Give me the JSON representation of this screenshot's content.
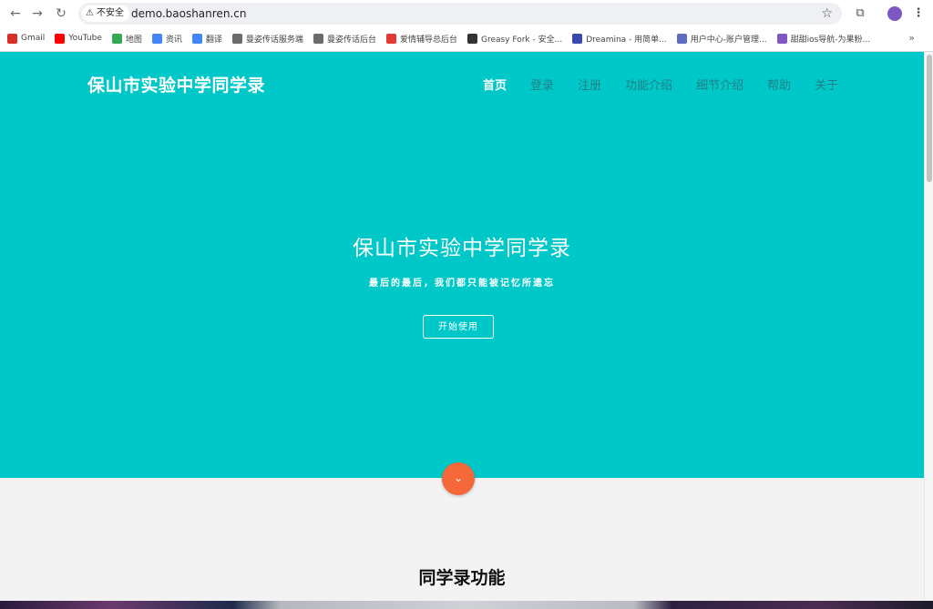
{
  "browser": {
    "security_label": "不安全",
    "url": "demo.baoshanren.cn",
    "bookmarks": [
      {
        "label": "Gmail",
        "color": "#d93025"
      },
      {
        "label": "YouTube",
        "color": "#ff0000"
      },
      {
        "label": "地图",
        "color": "#34a853"
      },
      {
        "label": "资讯",
        "color": "#4285f4"
      },
      {
        "label": "翻译",
        "color": "#4285f4"
      },
      {
        "label": "曼姿传话服务端",
        "color": "#6b6b6b"
      },
      {
        "label": "曼姿传话后台",
        "color": "#6b6b6b"
      },
      {
        "label": "爱情辅导总后台",
        "color": "#e53935"
      },
      {
        "label": "Greasy Fork - 安全...",
        "color": "#333333"
      },
      {
        "label": "Dreamina - 用简单...",
        "color": "#3949ab"
      },
      {
        "label": "用户中心-账户管理...",
        "color": "#5c6bc0"
      },
      {
        "label": "甜甜ios导航-为果粉...",
        "color": "#7e57c2"
      }
    ],
    "more": "»"
  },
  "site": {
    "brand": "保山市实验中学同学录",
    "nav": [
      {
        "label": "首页",
        "active": true
      },
      {
        "label": "登录",
        "active": false
      },
      {
        "label": "注册",
        "active": false
      },
      {
        "label": "功能介绍",
        "active": false
      },
      {
        "label": "细节介绍",
        "active": false
      },
      {
        "label": "帮助",
        "active": false
      },
      {
        "label": "关于",
        "active": false
      }
    ],
    "hero_title": "保山市实验中学同学录",
    "hero_subtitle": "最后的最后，我们都只能被记忆所遗忘",
    "start_button": "开始使用",
    "features_title": "同学录功能"
  },
  "colors": {
    "hero_bg": "#00c8c8",
    "accent_orange": "#f5683a",
    "nav_inactive": "#1f7f86"
  }
}
